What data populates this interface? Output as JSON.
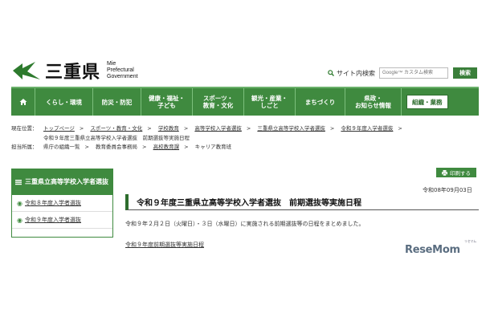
{
  "header": {
    "logo_name": "三重県",
    "logo_en": [
      "Mie",
      "Prefectural",
      "Government"
    ],
    "search_label": "サイト内検索",
    "search_placeholder": "Google™ カスタム検索",
    "search_button": "検索"
  },
  "nav": {
    "items": [
      {
        "line1": "くらし・環境",
        "line2": ""
      },
      {
        "line1": "防災・防犯",
        "line2": ""
      },
      {
        "line1": "健康・福祉・",
        "line2": "子ども"
      },
      {
        "line1": "スポーツ・",
        "line2": "教育・文化"
      },
      {
        "line1": "観光・産業・",
        "line2": "しごと"
      },
      {
        "line1": "まちづくり",
        "line2": ""
      },
      {
        "line1": "県政・",
        "line2": "お知らせ情報"
      }
    ],
    "last": "組織・業務"
  },
  "breadcrumb": {
    "current_label": "現在位置：",
    "current_items": [
      "トップページ",
      "スポーツ・教育・文化",
      "学校教育",
      "高等学校入学者選抜",
      "三重県立高等学校入学者選抜",
      "令和９年度入学者選抜"
    ],
    "current_tail": "令和９年度三重県立高等学校入学者選抜　前期選抜等実施日程",
    "dept_label": "担当所属：",
    "dept_items": [
      "県庁の組織一覧",
      "教育委員会事務局",
      "高校教育課",
      "キャリア教育班"
    ]
  },
  "sidebar": {
    "title": "三重県立高等学校入学者選抜",
    "items": [
      "令和８年度入学者選抜",
      "令和９年度入学者選抜"
    ]
  },
  "main": {
    "print_label": "印刷する",
    "date": "令和08年09月03日",
    "title": "令和９年度三重県立高等学校入学者選抜　前期選抜等実施日程",
    "body": "令和９年２月２日（火曜日）・３日（水曜日）に実施される前期選抜等の日程をまとめました。",
    "link": "令和９年度前期選抜等実施日程"
  },
  "watermark": {
    "text": "ReseMom",
    "small": "リセマム"
  },
  "colors": {
    "brand_green": "#3f8a3f"
  }
}
